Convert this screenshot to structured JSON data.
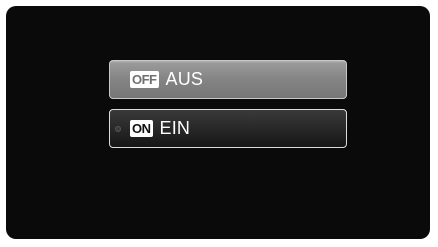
{
  "menu": {
    "options": [
      {
        "icon": "off-badge-icon",
        "badge": "OFF",
        "label": "AUS",
        "selected": false
      },
      {
        "icon": "on-badge-icon",
        "badge": "ON",
        "label": "EIN",
        "selected": true
      }
    ]
  },
  "colors": {
    "background": "#0a0a0a",
    "inactive_option": "#858585",
    "active_option": "#222222",
    "text": "#ffffff"
  }
}
